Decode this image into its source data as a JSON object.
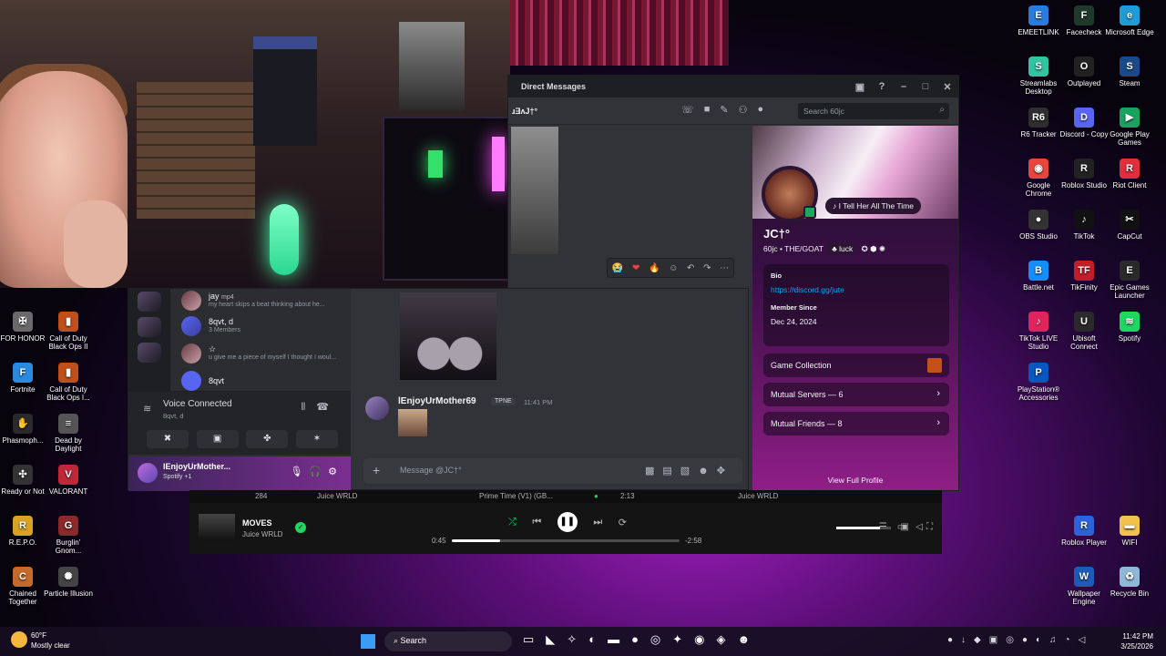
{
  "desktop_icons": [
    {
      "label": "EMEETLINK",
      "icon": "emeet-icon",
      "color": "#2a7be0",
      "glyph": "E"
    },
    {
      "label": "Facecheck",
      "icon": "facecheck-icon",
      "color": "#1f3a2a",
      "glyph": "F"
    },
    {
      "label": "Microsoft Edge",
      "icon": "edge-icon",
      "color": "#1f9cd8",
      "glyph": "e"
    },
    {
      "label": "Streamlabs Desktop",
      "icon": "streamlabs-icon",
      "color": "#31c3a2",
      "glyph": "S"
    },
    {
      "label": "Outplayed",
      "icon": "outplayed-icon",
      "color": "#222",
      "glyph": "O"
    },
    {
      "label": "Steam",
      "icon": "steam-icon",
      "color": "#1b4a8a",
      "glyph": "S"
    },
    {
      "label": "R6 Tracker",
      "icon": "r6tracker-icon",
      "color": "#2e2e2e",
      "glyph": "R6"
    },
    {
      "label": "Discord - Copy",
      "icon": "discord-icon",
      "color": "#5865f2",
      "glyph": "D"
    },
    {
      "label": "Google Play Games",
      "icon": "google-play-games-icon",
      "color": "#1aa260",
      "glyph": "▶"
    },
    {
      "label": "Google Chrome",
      "icon": "chrome-icon",
      "color": "#e8453c",
      "glyph": "◉"
    },
    {
      "label": "Roblox Studio",
      "icon": "roblox-studio-icon",
      "color": "#222",
      "glyph": "R"
    },
    {
      "label": "Riot Client",
      "icon": "riot-client-icon",
      "color": "#e02e3c",
      "glyph": "R"
    },
    {
      "label": "OBS Studio",
      "icon": "obs-icon",
      "color": "#333",
      "glyph": "●"
    },
    {
      "label": "TikTok",
      "icon": "tiktok-icon",
      "color": "#111",
      "glyph": "♪"
    },
    {
      "label": "CapCut",
      "icon": "capcut-icon",
      "color": "#111",
      "glyph": "✂"
    },
    {
      "label": "Battle.net",
      "icon": "battlenet-icon",
      "color": "#148eff",
      "glyph": "B"
    },
    {
      "label": "TikFinity",
      "icon": "tikfinity-icon",
      "color": "#c41d2a",
      "glyph": "TF"
    },
    {
      "label": "Epic Games Launcher",
      "icon": "epic-games-icon",
      "color": "#2a2a2a",
      "glyph": "E"
    },
    {
      "label": "TikTok LIVE Studio",
      "icon": "tiktok-live-icon",
      "color": "#e0245e",
      "glyph": "♪"
    },
    {
      "label": "Ubisoft Connect",
      "icon": "ubisoft-icon",
      "color": "#2a2a2a",
      "glyph": "U"
    },
    {
      "label": "Spotify",
      "icon": "spotify-icon",
      "color": "#1ed760",
      "glyph": "≋"
    },
    {
      "label": "PlayStation® Accessories",
      "icon": "playstation-icon",
      "color": "#0a57c2",
      "glyph": "P"
    },
    {
      "label": "Roblox Player",
      "icon": "roblox-player-icon",
      "color": "#2c63d8",
      "glyph": "R"
    },
    {
      "label": "WIFI",
      "icon": "folder-icon",
      "color": "#f2c14e",
      "glyph": "▬"
    },
    {
      "label": "Wallpaper Engine",
      "icon": "wallpaper-engine-icon",
      "color": "#1c5cb8",
      "glyph": "W"
    },
    {
      "label": "Recycle Bin",
      "icon": "recycle-bin-icon",
      "color": "#8fb8d8",
      "glyph": "♻"
    },
    {
      "label": "FOR HONOR",
      "icon": "for-honor-icon",
      "color": "#6a6a6a",
      "glyph": "✠"
    },
    {
      "label": "Call of Duty Black Ops II",
      "icon": "cod-bo2-icon",
      "color": "#c0501b",
      "glyph": "▮"
    },
    {
      "label": "Fortnite",
      "icon": "fortnite-icon",
      "color": "#2a8adf",
      "glyph": "F"
    },
    {
      "label": "Call of Duty Black Ops I...",
      "icon": "cod-bo-icon",
      "color": "#c0501b",
      "glyph": "▮"
    },
    {
      "label": "Phasmoph...",
      "icon": "phasmophobia-icon",
      "color": "#2a2a2a",
      "glyph": "✋"
    },
    {
      "label": "Dead by Daylight",
      "icon": "dead-by-daylight-icon",
      "color": "#555",
      "glyph": "≡"
    },
    {
      "label": "Ready or Not",
      "icon": "ready-or-not-icon",
      "color": "#333",
      "glyph": "✣"
    },
    {
      "label": "VALORANT",
      "icon": "valorant-icon",
      "color": "#c0283a",
      "glyph": "V"
    },
    {
      "label": "R.E.P.O.",
      "icon": "repo-icon",
      "color": "#d8a224",
      "glyph": "R"
    },
    {
      "label": "Burglin' Gnom...",
      "icon": "burglin-gnomes-icon",
      "color": "#8a2a2a",
      "glyph": "G"
    },
    {
      "label": "Chained Together",
      "icon": "chained-together-icon",
      "color": "#c46a2a",
      "glyph": "C"
    },
    {
      "label": "Particle Illusion",
      "icon": "particle-illusion-icon",
      "color": "#444",
      "glyph": "✺"
    }
  ],
  "dm_window": {
    "title": "Direct Messages",
    "header_name": "ɹƎᴧJ†°",
    "search_placeholder": "Search 60jc",
    "reactions": [
      "😭",
      "❤",
      "🔥",
      "☺",
      "↶",
      "↷",
      "⋯"
    ]
  },
  "profile": {
    "status": "I Tell Her All The Time",
    "display_name": "JC†°",
    "tagline": "60jc • THE/GOAT",
    "guild_tag": "luck",
    "bio_label": "Bio",
    "bio_link": "https://discord.gg/jute",
    "member_since_label": "Member Since",
    "member_since": "Dec 24, 2024",
    "game_collection": "Game Collection",
    "mutual_servers": "Mutual Servers — 6",
    "mutual_friends": "Mutual Friends — 8",
    "view_full_profile": "View Full Profile"
  },
  "dm_list": [
    {
      "name": "jay",
      "sub": "my heart skips a beat thinking about he...",
      "tag": "mp4"
    },
    {
      "name": "8qvt, d",
      "sub": "3 Members"
    },
    {
      "name": "☆",
      "sub": "u give me a piece of myself I thought I woul..."
    },
    {
      "name": "8qvt",
      "sub": ""
    }
  ],
  "voice": {
    "status": "Voice Connected",
    "channel": "8qvt, d",
    "buttons": [
      "✖",
      "▣",
      "✤",
      "✶"
    ]
  },
  "user_panel": {
    "name": "lEnjoyUrMother...",
    "activity": "Spotify +1"
  },
  "message": {
    "author": "lEnjoyUrMother69",
    "tag": "TPNE",
    "time": "11:41 PM",
    "composer_placeholder": "Message @JC†°"
  },
  "spotify": {
    "prev_row": {
      "num": "284",
      "title": "Prime Time (V1) (GB...",
      "artist": "Juice WRLD",
      "artist_left": "Juice WRLD",
      "duration": "2:13"
    },
    "track": "MOVES",
    "artist": "Juice WRLD",
    "elapsed": "0:45",
    "remaining": "-2:58",
    "progress": 0.21,
    "volume": 0.8
  },
  "taskbar": {
    "temp": "60°F",
    "weather": "Mostly clear",
    "search": "Search",
    "time": "11:42 PM",
    "date": "3/25/2026"
  }
}
